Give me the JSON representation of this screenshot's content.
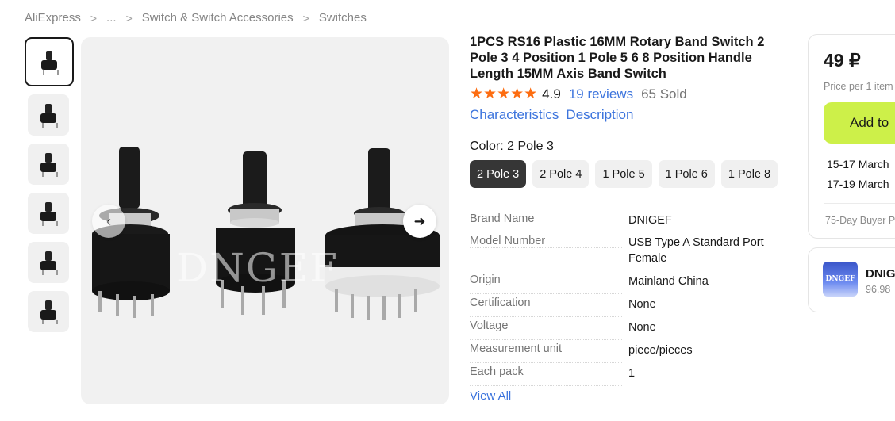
{
  "breadcrumb": [
    "AliExpress",
    "...",
    "Switch & Switch Accessories",
    "Switches"
  ],
  "gallery": {
    "watermark": "DNGEF",
    "prev_icon": "chevron-left-icon",
    "next_icon": "arrow-right-icon",
    "next_glyph": "➜",
    "thumbnail_count": 6
  },
  "product": {
    "title": "1PCS RS16 Plastic 16MM Rotary Band Switch 2 Pole 3 4 Position 1 Pole 5 6 8 Position Handle Length 15MM Axis Band Switch",
    "stars": "★★★★★",
    "rating": "4.9",
    "reviews": "19 reviews",
    "sold": "65 Sold",
    "links": {
      "characteristics": "Characteristics",
      "description": "Description"
    },
    "color_label": "Color: 2 Pole 3",
    "variants": [
      "2 Pole 3",
      "2 Pole 4",
      "1 Pole 5",
      "1 Pole 6",
      "1 Pole 8"
    ],
    "specs": [
      {
        "key": "Brand Name",
        "value": "DNIGEF"
      },
      {
        "key": "Model Number",
        "value": "USB Type A Standard Port Female"
      },
      {
        "key": "Origin",
        "value": "Mainland China"
      },
      {
        "key": "Certification",
        "value": "None"
      },
      {
        "key": "Voltage",
        "value": "None"
      },
      {
        "key": "Measurement unit",
        "value": "piece/pieces"
      },
      {
        "key": "Each pack",
        "value": "1"
      }
    ],
    "view_all": "View All"
  },
  "buy_box": {
    "price": "49 ₽",
    "price_note": "Price per 1 item",
    "add_button": "Add to",
    "delivery_1": "15-17 March",
    "delivery_2": "17-19 March",
    "protection": "75-Day Buyer P"
  },
  "store": {
    "logo_text": "DNGEF",
    "name": "DNIG",
    "rating": "96,98"
  },
  "colors": {
    "accent_link": "#3c74dd",
    "star": "#fd6d11",
    "add_button": "#cdf049",
    "active_variant": "#363636"
  }
}
